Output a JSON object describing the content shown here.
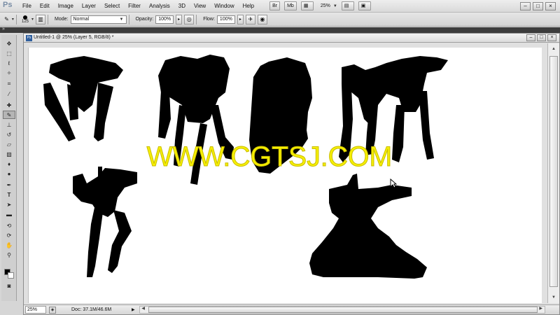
{
  "app": {
    "logo": "Ps",
    "menu": [
      "File",
      "Edit",
      "Image",
      "Layer",
      "Select",
      "Filter",
      "Analysis",
      "3D",
      "View",
      "Window",
      "Help"
    ],
    "menubar_buttons": [
      "Br",
      "Mb"
    ],
    "zoom_combo": "25%"
  },
  "options": {
    "brush_size": "125",
    "mode_label": "Mode:",
    "mode_value": "Normal",
    "opacity_label": "Opacity:",
    "opacity_value": "100%",
    "flow_label": "Flow:",
    "flow_value": "100%"
  },
  "document": {
    "title": "Untitled-1 @ 25% (Layer 5, RGB/8) *",
    "zoom": "25%",
    "doc_size": "Doc: 37.1M/46.6M"
  },
  "watermark": "WWW.CGTSJ.COM",
  "colors": {
    "foreground": "#000000",
    "background": "#ffffff",
    "watermark": "#f6ef00"
  },
  "icons": {
    "tools": [
      "move-icon",
      "marquee-icon",
      "lasso-icon",
      "quick-select-icon",
      "crop-icon",
      "eyedropper-icon",
      "spot-heal-icon",
      "brush-icon",
      "clone-stamp-icon",
      "history-brush-icon",
      "eraser-icon",
      "gradient-icon",
      "blur-icon",
      "dodge-icon",
      "pen-icon",
      "type-icon",
      "path-select-icon",
      "shape-icon",
      "3d-rotate-icon",
      "3d-orbit-icon",
      "hand-icon",
      "zoom-icon"
    ]
  }
}
